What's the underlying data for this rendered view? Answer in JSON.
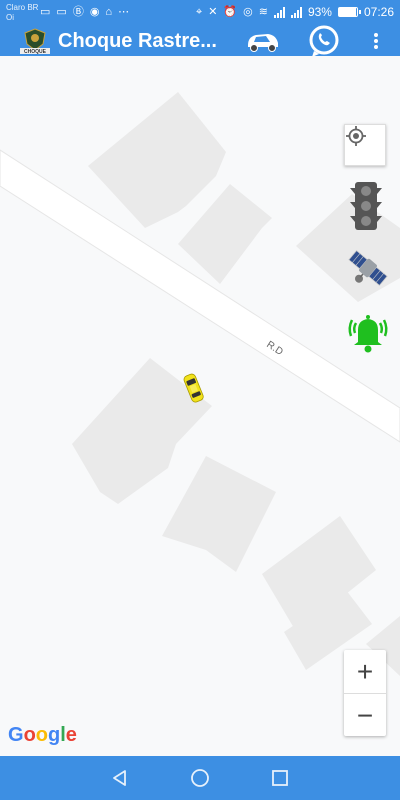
{
  "status_bar": {
    "carrier_line1": "Claro BR",
    "carrier_line2": "Oi",
    "battery": "93%",
    "battery_level": 0.93,
    "time": "07:26"
  },
  "app_bar": {
    "title": "Choque Rastre...",
    "logo_text": "CHOQUE",
    "icons": [
      "car-icon",
      "whatsapp-icon",
      "more-vert-icon"
    ]
  },
  "map": {
    "road_label": "R.D",
    "attribution": "Google",
    "zoom_in": "+",
    "zoom_out": "−",
    "controls": [
      "my-location-icon",
      "traffic-light-icon",
      "satellite-icon",
      "alarm-bell-icon"
    ]
  },
  "colors": {
    "primary": "#3d8fe3",
    "bell": "#1fbf1f",
    "vehicle": "#f2e21a"
  },
  "nav_bar": {
    "icons": [
      "back-icon",
      "home-icon",
      "recents-icon"
    ]
  }
}
